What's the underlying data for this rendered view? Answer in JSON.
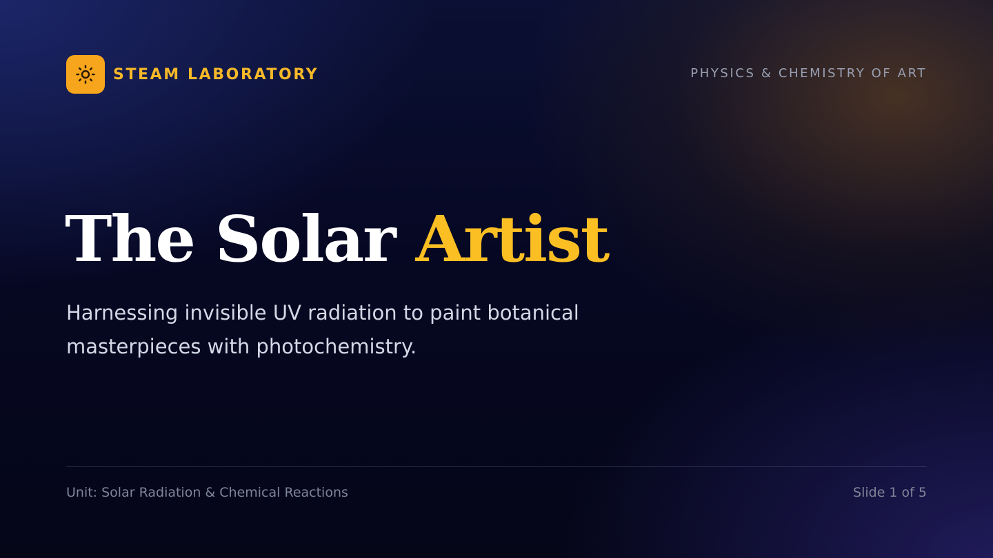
{
  "header": {
    "brand_icon": "sun-icon",
    "brand_name": "STEAM LABORATORY",
    "course_label": "PHYSICS & CHEMISTRY OF ART"
  },
  "hero": {
    "title_main": "The Solar",
    "title_accent": "Artist",
    "subtitle": "Harnessing invisible UV radiation to paint botanical masterpieces with photochemistry."
  },
  "footer": {
    "unit": "Unit: Solar Radiation & Chemical Reactions",
    "slide_indicator": "Slide 1 of 5"
  },
  "colors": {
    "accent": "#fbbf24",
    "badge": "#f7a51c",
    "background": "#060823"
  }
}
